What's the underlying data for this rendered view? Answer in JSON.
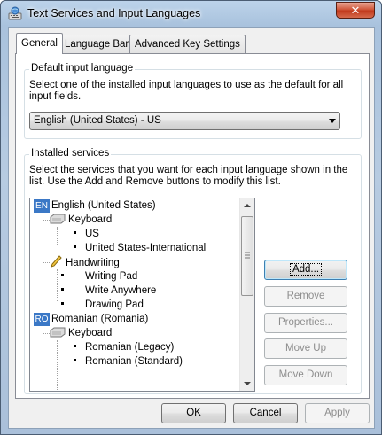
{
  "window": {
    "title": "Text Services and Input Languages",
    "close_label": "✕"
  },
  "tabs": [
    {
      "label": "General",
      "active": true
    },
    {
      "label": "Language Bar",
      "active": false
    },
    {
      "label": "Advanced Key Settings",
      "active": false
    }
  ],
  "default_language": {
    "group_label": "Default input language",
    "description": "Select one of the installed input languages to use as the default for all input fields.",
    "selected": "English (United States) - US"
  },
  "installed_services": {
    "group_label": "Installed services",
    "description": "Select the services that you want for each input language shown in the list. Use the Add and Remove buttons to modify this list.",
    "tree": {
      "lang1": {
        "badge": "EN",
        "label": "English (United States)"
      },
      "keyboard1": "Keyboard",
      "kb1_items": [
        "US",
        "United States-International"
      ],
      "handwriting": "Handwriting",
      "hw_items": [
        "Writing Pad",
        "Write Anywhere",
        "Drawing Pad"
      ],
      "lang2": {
        "badge": "RO",
        "label": "Romanian (Romania)"
      },
      "keyboard2": "Keyboard",
      "kb2_items": [
        "Romanian (Legacy)",
        "Romanian (Standard)"
      ]
    },
    "buttons": {
      "add": "Add...",
      "remove": "Remove",
      "properties": "Properties...",
      "move_up": "Move Up",
      "move_down": "Move Down"
    }
  },
  "footer": {
    "ok": "OK",
    "cancel": "Cancel",
    "apply": "Apply"
  },
  "icons": {
    "title": "keyboard-globe-icon",
    "keyboard": "keyboard-icon",
    "handwriting": "pen-icon"
  },
  "colors": {
    "badge": "#3b78c6",
    "close": "#c13a1d"
  }
}
